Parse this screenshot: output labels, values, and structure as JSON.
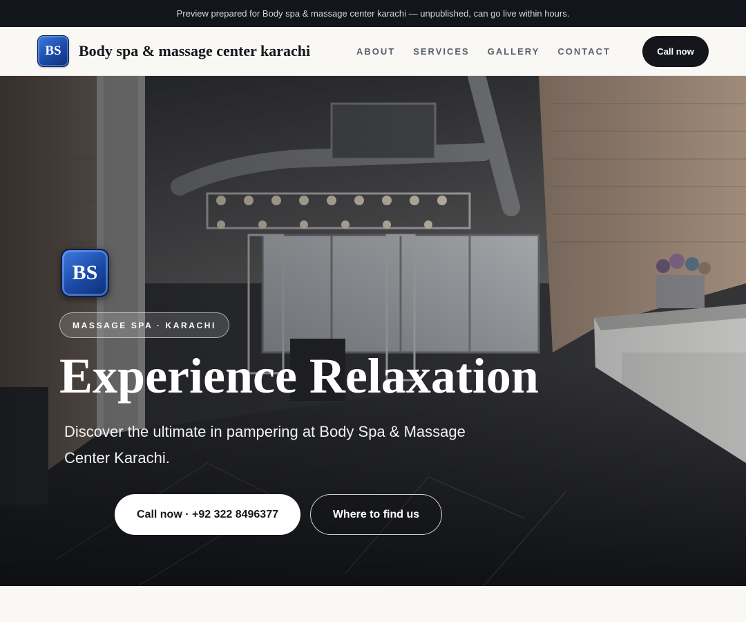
{
  "preview_banner": "Preview prepared for Body spa & massage center karachi — unpublished, can go live within hours.",
  "header": {
    "logo_text": "BS",
    "brand_name": "Body spa & massage center karachi",
    "nav": [
      "ABOUT",
      "SERVICES",
      "GALLERY",
      "CONTACT"
    ],
    "cta_label": "Call now"
  },
  "hero": {
    "logo_text": "BS",
    "tag": "MASSAGE SPA · KARACHI",
    "title": "Experience Relaxation",
    "subtitle": "Discover the ultimate in pampering at Body Spa & Massage Center Karachi.",
    "primary_button": "Call now · +92 322 8496377",
    "secondary_button": "Where to find us",
    "background_image": "spa-interior-photo"
  },
  "colors": {
    "accent_dark": "#14161c",
    "logo_blue": "#1a4aa6",
    "page_bg": "#f9f8f5"
  }
}
